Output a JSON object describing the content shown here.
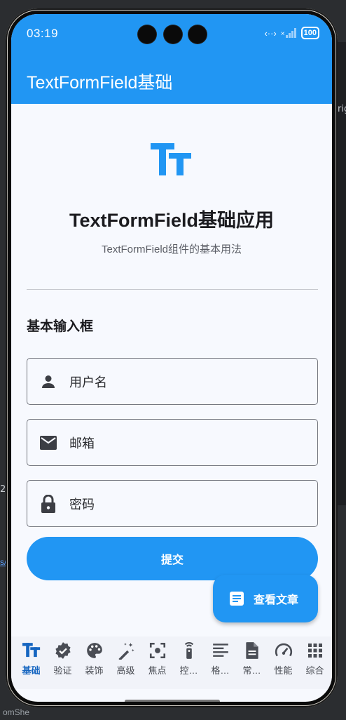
{
  "background": {
    "side_text_1": "rig",
    "side_text_2": "2)",
    "link_text": "s/",
    "bottom_text": "omShe"
  },
  "status_bar": {
    "time": "03:19",
    "network_text": "‹··›",
    "signal_text": "×",
    "battery": "100"
  },
  "app_bar": {
    "title": "TextFormField基础"
  },
  "header": {
    "logo_icon": "text-fields-icon",
    "title": "TextFormField基础应用",
    "subtitle": "TextFormField组件的基本用法"
  },
  "section": {
    "title": "基本输入框"
  },
  "fields": [
    {
      "label": "用户名",
      "icon": "person-icon"
    },
    {
      "label": "邮箱",
      "icon": "email-icon"
    },
    {
      "label": "密码",
      "icon": "lock-icon"
    }
  ],
  "submit_label": "提交",
  "fab_label": "查看文章",
  "bottom_nav": [
    {
      "label": "基础",
      "icon": "text-fields-icon",
      "active": true
    },
    {
      "label": "验证",
      "icon": "verified-icon"
    },
    {
      "label": "装饰",
      "icon": "palette-icon"
    },
    {
      "label": "高级",
      "icon": "magic-wand-icon"
    },
    {
      "label": "焦点",
      "icon": "focus-icon"
    },
    {
      "label": "控…",
      "icon": "remote-icon"
    },
    {
      "label": "格…",
      "icon": "format-icon"
    },
    {
      "label": "常…",
      "icon": "document-icon"
    },
    {
      "label": "性能",
      "icon": "speed-icon"
    },
    {
      "label": "综合",
      "icon": "grid-icon"
    }
  ],
  "colors": {
    "primary": "#2196f3",
    "background": "#f7f9fe",
    "active_nav": "#1565c0"
  }
}
